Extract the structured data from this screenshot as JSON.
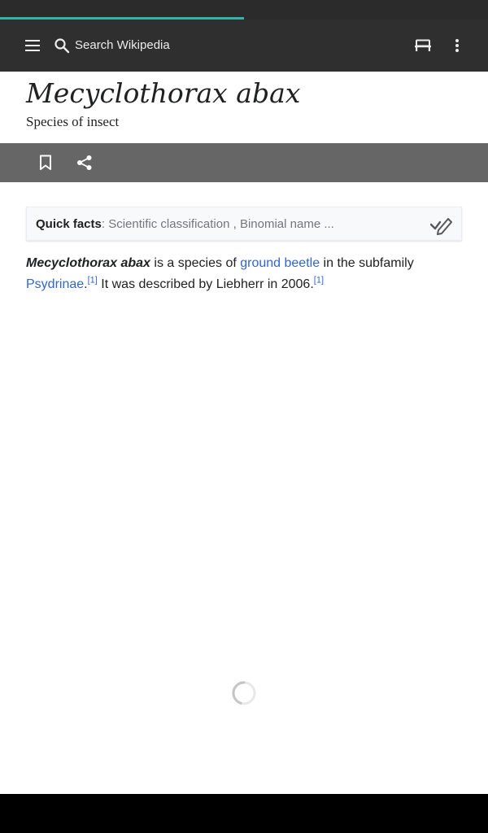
{
  "loading": {
    "progress": 0.5
  },
  "toolbar": {
    "search_placeholder": "Search Wikipedia",
    "icons": [
      "menu-icon",
      "search-icon",
      "reading-lists-icon",
      "overflow-menu-icon"
    ]
  },
  "article": {
    "title": "Mecyclothorax abax",
    "subtitle": "Species of insect"
  },
  "actions": {
    "icons": [
      "bookmark-icon",
      "share-icon"
    ]
  },
  "quick_facts": {
    "label": "Quick facts",
    "separator": ": ",
    "summary": "Scientific classification , Binomial name ..."
  },
  "paragraph": {
    "subject": "Mecyclothorax abax",
    "text_1": " is a species of ",
    "link_1": "ground beetle",
    "text_2": " in the subfamily ",
    "link_2": "Psydrinae",
    "text_3": ".",
    "ref_1": "[1]",
    "text_4": " It was described by Liebherr in 2006.",
    "ref_2": "[1]"
  },
  "colors": {
    "accent": "#36b3a8",
    "link": "#3366cc",
    "toolbar": "#2f2f2f",
    "action_bar": "#666666"
  }
}
